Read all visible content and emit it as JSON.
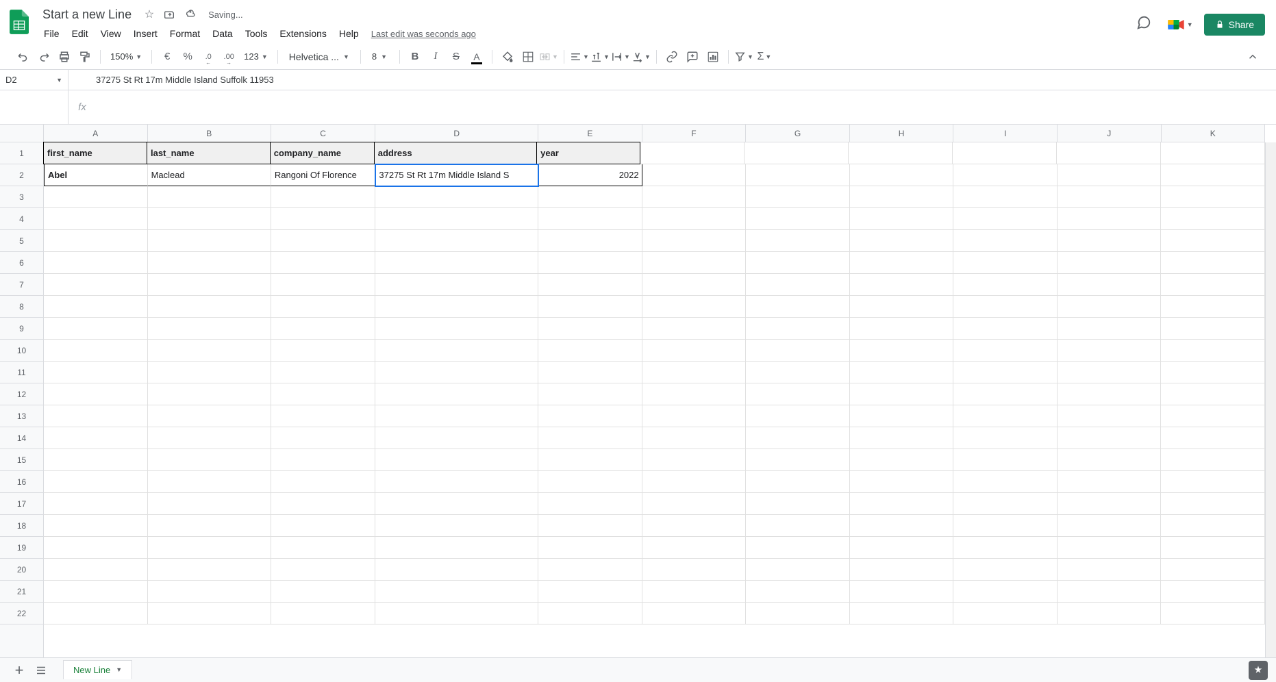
{
  "doc": {
    "title": "Start a new Line",
    "saving": "Saving...",
    "last_edit": "Last edit was seconds ago"
  },
  "menu": {
    "file": "File",
    "edit": "Edit",
    "view": "View",
    "insert": "Insert",
    "format": "Format",
    "data": "Data",
    "tools": "Tools",
    "extensions": "Extensions",
    "help": "Help"
  },
  "toolbar": {
    "zoom": "150%",
    "currency": "€",
    "percent": "%",
    "dec_dec": ".0",
    "inc_dec": ".00",
    "num_format": "123",
    "font": "Helvetica ...",
    "font_size": "8"
  },
  "share": "Share",
  "name_box": "D2",
  "formula_bar": "37275 St Rt 17m Middle Island Suffolk 11953",
  "columns": [
    "A",
    "B",
    "C",
    "D",
    "E",
    "F",
    "G",
    "H",
    "I",
    "J",
    "K"
  ],
  "col_widths": [
    "cw-A",
    "cw-B",
    "cw-C",
    "cw-D",
    "cw-E",
    "cw-F",
    "cw-G",
    "cw-H",
    "cw-I",
    "cw-J",
    "cw-K"
  ],
  "rows": [
    "1",
    "2",
    "3",
    "4",
    "5",
    "6",
    "7",
    "8",
    "9",
    "10",
    "11",
    "12",
    "13",
    "14",
    "15",
    "16",
    "17",
    "18",
    "19",
    "20",
    "21",
    "22"
  ],
  "headers": [
    "first_name",
    "last_name",
    "company_name",
    "address",
    "year"
  ],
  "data_row": {
    "first_name": "Abel",
    "last_name": "Maclead",
    "company_name": "Rangoni Of Florence",
    "address_display": "37275 St Rt 17m Middle Island S",
    "year": "2022"
  },
  "sheet_tab": "New Line"
}
